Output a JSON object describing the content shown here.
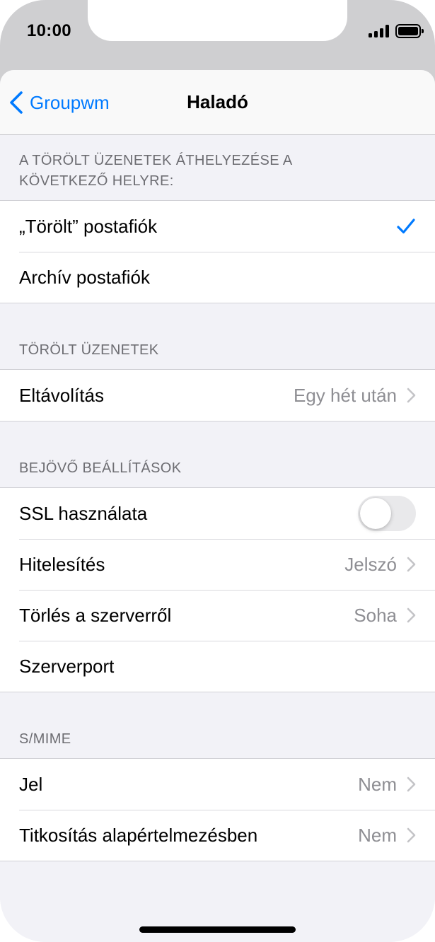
{
  "status_bar": {
    "time": "10:00"
  },
  "navbar": {
    "back_label": "Groupwm",
    "title": "Haladó"
  },
  "sections": {
    "move_deleted": {
      "header_line1": "A TÖRÖLT ÜZENETEK ÁTHELYEZÉSE A",
      "header_line2": "KÖVETKEZŐ HELYRE:",
      "rows": [
        {
          "label": "„Törölt” postafiók",
          "checked": true
        },
        {
          "label": "Archív postafiók",
          "checked": false
        }
      ]
    },
    "deleted_messages": {
      "header": "TÖRÖLT ÜZENETEK",
      "rows": [
        {
          "label": "Eltávolítás",
          "value": "Egy hét után"
        }
      ]
    },
    "incoming": {
      "header": "BEJÖVŐ BEÁLLÍTÁSOK",
      "rows": [
        {
          "label": "SSL használata",
          "toggle": false
        },
        {
          "label": "Hitelesítés",
          "value": "Jelszó"
        },
        {
          "label": "Törlés a szerverről",
          "value": "Soha"
        },
        {
          "label": "Szerverport"
        }
      ]
    },
    "smime": {
      "header": "S/MIME",
      "rows": [
        {
          "label": "Jel",
          "value": "Nem"
        },
        {
          "label": "Titkosítás alapértelmezésben",
          "value": "Nem"
        }
      ]
    }
  },
  "colors": {
    "accent": "#007aff",
    "secondary_text": "#8e8e93",
    "grouped_bg": "#f2f2f7"
  },
  "icons": [
    "chevron-left-icon",
    "checkmark-icon",
    "chevron-right-icon",
    "cellular-signal-icon",
    "battery-icon"
  ]
}
